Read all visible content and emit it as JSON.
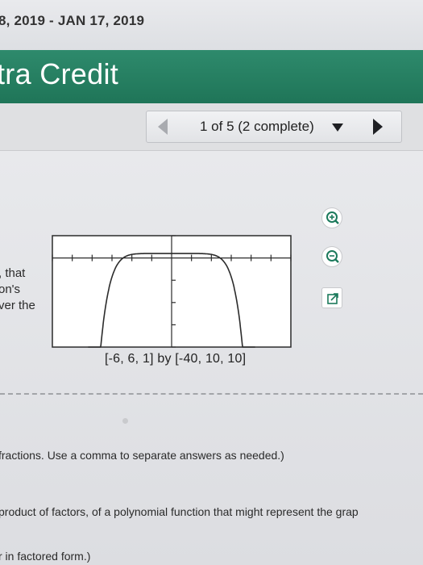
{
  "header": {
    "date_range": "8, 2019 - JAN 17, 2019",
    "title": "tra Credit"
  },
  "navigation": {
    "position": "1 of 5 (2 complete)",
    "prev_icon": "triangle-left-icon",
    "next_icon": "triangle-right-icon",
    "dropdown_icon": "caret-down-icon"
  },
  "question": {
    "lines": [
      ", that",
      "on's",
      "ver the"
    ]
  },
  "graph": {
    "window_label": "[-6, 6, 1] by [-40, 10, 10]",
    "x_range": [
      -6,
      6
    ],
    "x_scale": 1,
    "y_range": [
      -40,
      10
    ],
    "y_scale": 10
  },
  "tools": {
    "zoom_in": "zoom-in-icon",
    "zoom_out": "zoom-out-icon",
    "popout": "popout-icon"
  },
  "instructions": {
    "fractions_note": "fractions. Use a comma to separate answers as needed.)",
    "factors_prompt": "product of factors, of a polynomial function that might represent the grap",
    "factored_note": "r in factored form.)"
  },
  "colors": {
    "banner": "#23795c",
    "nav_arrow_active": "#1f2024",
    "nav_arrow_disabled": "#a9abb0"
  }
}
